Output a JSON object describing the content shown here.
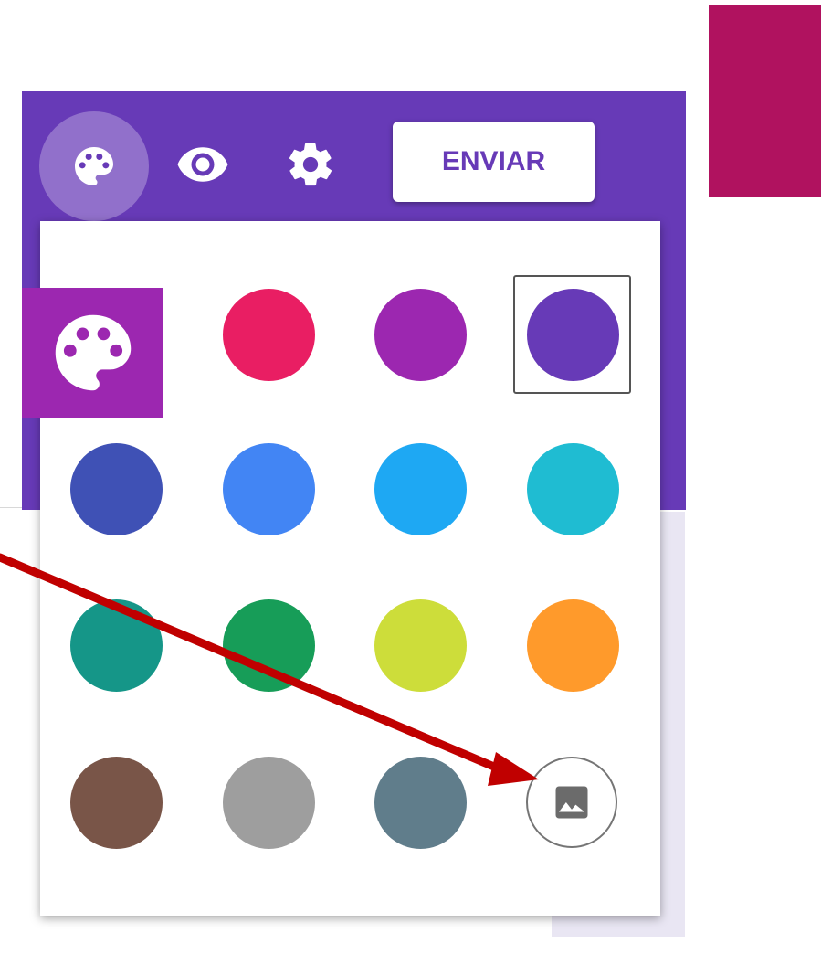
{
  "colors": {
    "theme": "#673ab7",
    "corner_swatch": "#b0125f",
    "palette_overlay": "#9c27b0",
    "annotation_arrow": "#c00000",
    "send_text": "#673ab7"
  },
  "toolbar": {
    "palette_icon": "palette-icon",
    "preview_icon": "eye-icon",
    "settings_icon": "gear-icon",
    "send_label": "ENVIAR"
  },
  "color_panel": {
    "selected_index": 3,
    "swatches": [
      "#673ab7",
      "#e91e63",
      "#9c27b0",
      "#673ab7",
      "#3f51b5",
      "#4285f4",
      "#1ea8f3",
      "#1fbcd2",
      "#159688",
      "#179d58",
      "#cddd3a",
      "#ff9a2b",
      "#795548",
      "#9e9e9e",
      "#607d8b"
    ],
    "upload_icon": "image-icon"
  },
  "annotation": {
    "arrow_icon": "arrow-icon"
  }
}
